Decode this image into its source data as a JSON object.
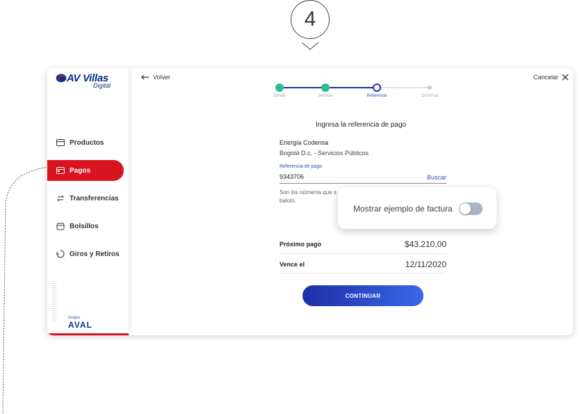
{
  "step": {
    "number": "4"
  },
  "brand": {
    "name": "AV Villas",
    "sub": "Digital",
    "group_small": "Grupo",
    "group_name": "AVAL",
    "accent": "#d7141f",
    "primary": "#0b2f8a"
  },
  "sidebar": {
    "items": [
      {
        "label": "Productos",
        "icon": "card-icon"
      },
      {
        "label": "Pagos",
        "icon": "payment-icon",
        "active": true
      },
      {
        "label": "Transferencias",
        "icon": "transfer-icon"
      },
      {
        "label": "Bolsillos",
        "icon": "pocket-icon"
      },
      {
        "label": "Giros y Retiros",
        "icon": "withdraw-icon"
      }
    ]
  },
  "header": {
    "back_label": "Volver",
    "cancel_label": "Cancelar"
  },
  "stepper": {
    "steps": [
      {
        "label": "Desde",
        "state": "done"
      },
      {
        "label": "Servicio",
        "state": "done"
      },
      {
        "label": "Referencia",
        "state": "current"
      },
      {
        "label": "Confirma",
        "state": "pending"
      }
    ]
  },
  "form": {
    "title": "Ingresa la referencia de pago",
    "company": "Energía Codensa",
    "company_sub": "Bogotá D.c. - Servicios Públicos",
    "ref_label": "Referencia de pago",
    "ref_value": "9343706",
    "search_label": "Buscar",
    "help_text": "Son los números que s o vía baloto."
  },
  "tooltip": {
    "text": "Mostrar ejemplo de factura",
    "toggle_on": false
  },
  "summary": {
    "next_payment_label": "Próximo pago",
    "next_payment_value": "$43.210,00",
    "due_label": "Vence el",
    "due_value": "12/11/2020"
  },
  "cta": {
    "label": "CONTINUAR"
  }
}
